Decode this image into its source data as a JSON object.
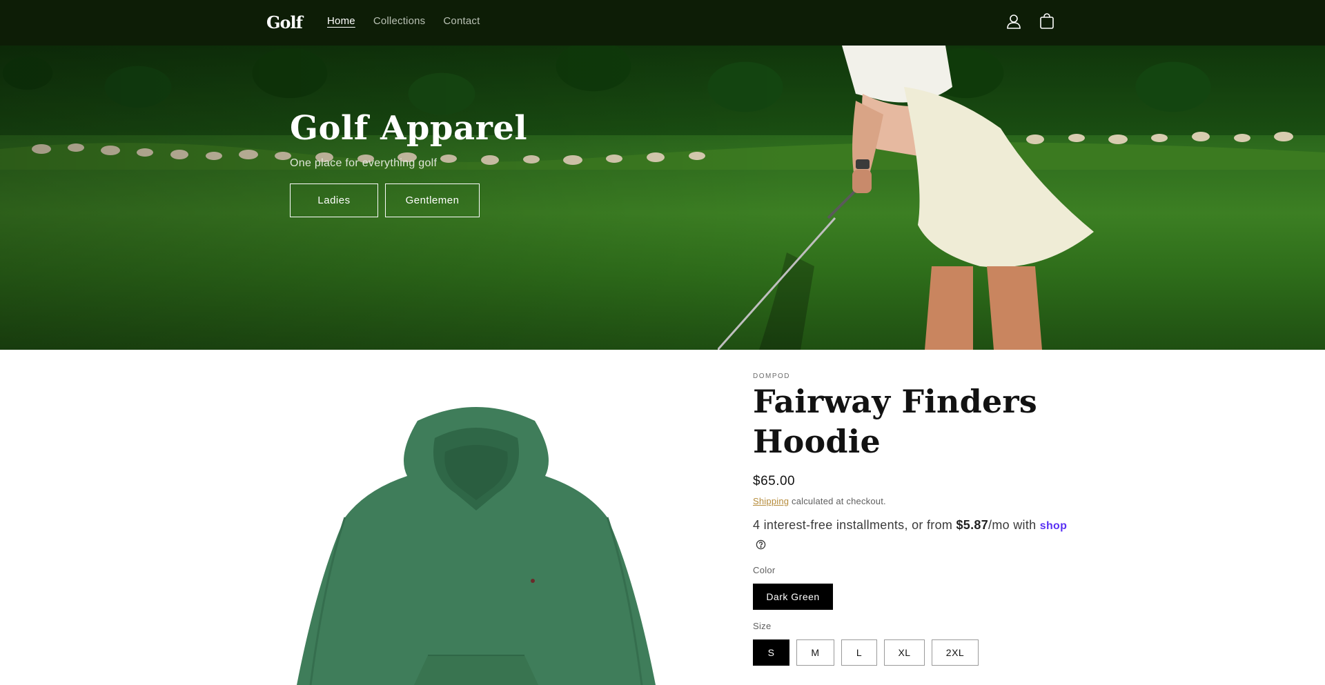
{
  "header": {
    "logo_text": "Golf",
    "nav": [
      {
        "label": "Home",
        "active": true
      },
      {
        "label": "Collections",
        "active": false
      },
      {
        "label": "Contact",
        "active": false
      }
    ],
    "icons": [
      "account-icon",
      "cart-icon"
    ]
  },
  "hero": {
    "title": "Golf Apparel",
    "subtitle": "One place for everything golf",
    "buttons": {
      "ladies": "Ladies",
      "gentlemen": "Gentlemen"
    }
  },
  "product": {
    "vendor": "DOMPOD",
    "title": "Fairway Finders Hoodie",
    "price": "$65.00",
    "shipping_link": "Shipping",
    "shipping_rest": " calculated at checkout.",
    "installments_pre": "4 interest-free installments, or from ",
    "installments_amount": "$5.87",
    "installments_post": "/mo with ",
    "shop_pay_label": "shop",
    "color_label": "Color",
    "color_value": "Dark Green",
    "size_label": "Size",
    "sizes": [
      "S",
      "M",
      "L",
      "XL",
      "2XL"
    ],
    "selected_size": "S",
    "hoodie_color": "#3f7d5a"
  },
  "colors": {
    "header_bg": "#0d1d06",
    "accent_link": "#b58b3a",
    "shop_pay": "#5a31f4"
  }
}
